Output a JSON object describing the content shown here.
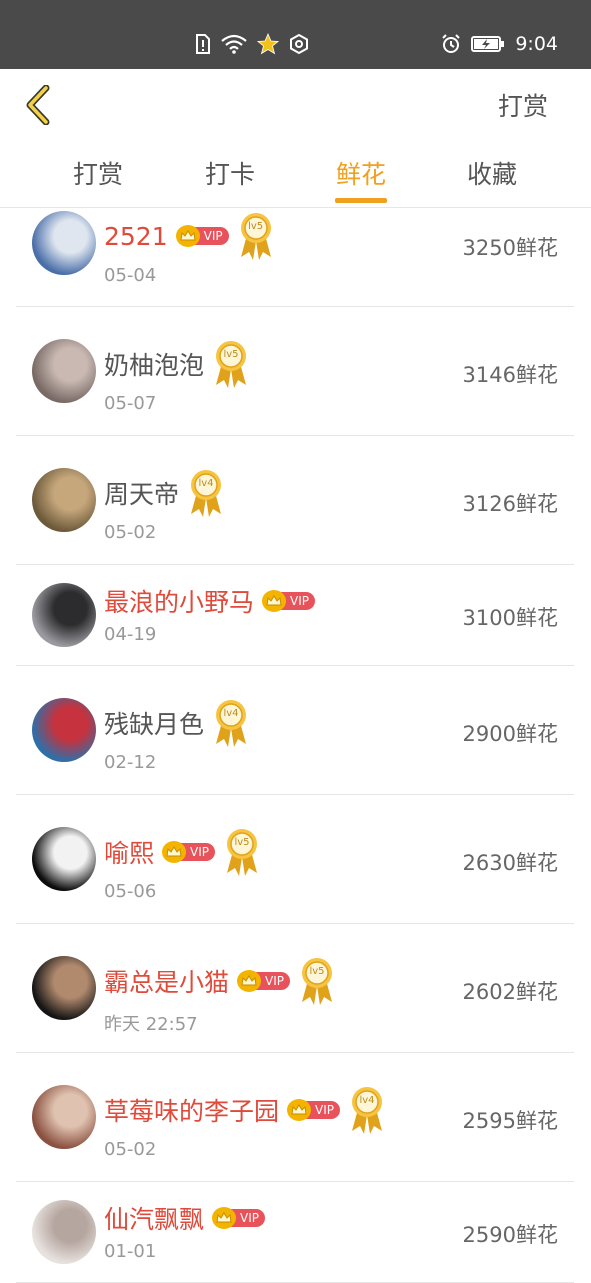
{
  "status_bar": {
    "time": "9:04",
    "icons": [
      "sim-alert-icon",
      "wifi-icon",
      "star-icon",
      "hexagon-icon",
      "alarm-icon",
      "battery-icon"
    ]
  },
  "header": {
    "back_icon": "chevron-left-icon",
    "action_label": "打赏"
  },
  "tabs": [
    {
      "label": "打赏",
      "active": false
    },
    {
      "label": "打卡",
      "active": false
    },
    {
      "label": "鲜花",
      "active": true
    },
    {
      "label": "收藏",
      "active": false
    }
  ],
  "colors": {
    "accent": "#f0a020",
    "vip_name": "#e04a3a",
    "vip_badge": "#e8525a",
    "medal_gold": "#f3b400"
  },
  "ranking": [
    {
      "name": "2521",
      "vip": true,
      "level": "lv5",
      "date": "05-04",
      "amount": "3250鲜花"
    },
    {
      "name": "奶柚泡泡",
      "vip": false,
      "level": "lv5",
      "date": "05-07",
      "amount": "3146鲜花"
    },
    {
      "name": "周天帝",
      "vip": false,
      "level": "lv4",
      "date": "05-02",
      "amount": "3126鲜花"
    },
    {
      "name": "最浪的小野马",
      "vip": true,
      "level": "",
      "date": "04-19",
      "amount": "3100鲜花"
    },
    {
      "name": "残缺月色",
      "vip": false,
      "level": "lv4",
      "date": "02-12",
      "amount": "2900鲜花"
    },
    {
      "name": "喻熙",
      "vip": true,
      "level": "lv5",
      "date": "05-06",
      "amount": "2630鲜花"
    },
    {
      "name": "霸总是小猫",
      "vip": true,
      "level": "lv5",
      "date": "昨天 22:57",
      "amount": "2602鲜花"
    },
    {
      "name": "草莓味的李子园",
      "vip": true,
      "level": "lv4",
      "date": "05-02",
      "amount": "2595鲜花"
    },
    {
      "name": "仙汽飘飘",
      "vip": true,
      "level": "",
      "date": "01-01",
      "amount": "2590鲜花"
    }
  ],
  "vip_badge_label": "VIP"
}
